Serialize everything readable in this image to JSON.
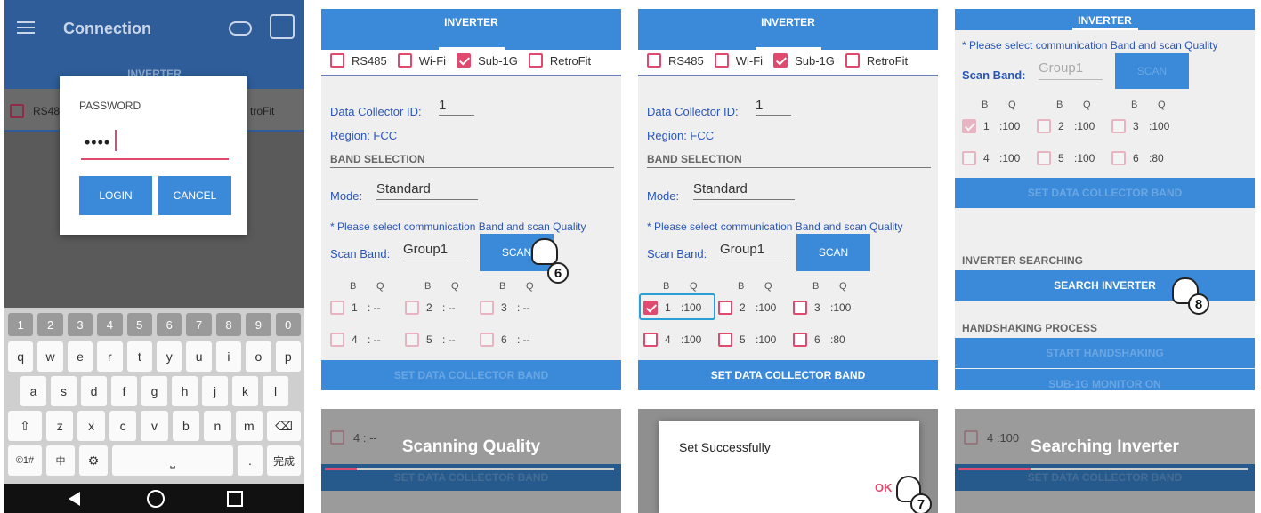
{
  "p1": {
    "title": "Connection",
    "tab": "INVERTER",
    "cb": [
      "RS48",
      "troFit"
    ],
    "dialog_label": "PASSWORD",
    "password": "••••",
    "login": "LOGIN",
    "cancel": "CANCEL",
    "num_keys": [
      "1",
      "2",
      "3",
      "4",
      "5",
      "6",
      "7",
      "8",
      "9",
      "0"
    ],
    "row1": [
      "q",
      "w",
      "e",
      "r",
      "t",
      "y",
      "u",
      "i",
      "o",
      "p"
    ],
    "row2": [
      "a",
      "s",
      "d",
      "f",
      "g",
      "h",
      "j",
      "k",
      "l"
    ],
    "row3": [
      "z",
      "x",
      "c",
      "v",
      "b",
      "n",
      "m"
    ],
    "sym": "©1#",
    "done": "完成"
  },
  "p2": {
    "tab": "INVERTER",
    "cbs": [
      "RS485",
      "Wi-Fi",
      "Sub-1G",
      "RetroFit"
    ],
    "dc_label": "Data Collector ID:",
    "dc_val": "1",
    "region": "Region:  FCC",
    "band_sel": "BAND SELECTION",
    "mode_label": "Mode:",
    "mode_val": "Standard",
    "note": "* Please select communication Band and scan Quality",
    "scan_band": "Scan Band:",
    "group": "Group1",
    "scan": "SCAN",
    "bq": [
      "B",
      "Q"
    ],
    "opts": [
      [
        "1",
        ":  --"
      ],
      [
        "2",
        ":  --"
      ],
      [
        "3",
        ":  --"
      ],
      [
        "4",
        ":  --"
      ],
      [
        "5",
        ":  --"
      ],
      [
        "6",
        ":  --"
      ]
    ],
    "set_btn": "SET DATA COLLECTOR BAND",
    "step": "6"
  },
  "p3": {
    "tab": "INVERTER",
    "cbs": [
      "RS485",
      "Wi-Fi",
      "Sub-1G",
      "RetroFit"
    ],
    "dc_label": "Data Collector ID:",
    "dc_val": "1",
    "region": "Region:  FCC",
    "band_sel": "BAND SELECTION",
    "mode_label": "Mode:",
    "mode_val": "Standard",
    "note": "* Please select communication Band and scan Quality",
    "scan_band": "Scan Band:",
    "group": "Group1",
    "scan": "SCAN",
    "bq": [
      "B",
      "Q"
    ],
    "opts": [
      [
        "1",
        ":100"
      ],
      [
        "2",
        ":100"
      ],
      [
        "3",
        ":100"
      ],
      [
        "4",
        ":100"
      ],
      [
        "5",
        ":100"
      ],
      [
        "6",
        ":80"
      ]
    ],
    "set_btn": "SET DATA COLLECTOR BAND"
  },
  "p4": {
    "tab": "INVERTER",
    "note": "* Please select communication Band and scan Quality",
    "scan_band": "Scan Band:",
    "group": "Group1",
    "scan": "SCAN",
    "bq": [
      "B",
      "Q"
    ],
    "opts": [
      [
        "1",
        ":100"
      ],
      [
        "2",
        ":100"
      ],
      [
        "3",
        ":100"
      ],
      [
        "4",
        ":100"
      ],
      [
        "5",
        ":100"
      ],
      [
        "6",
        ":80"
      ]
    ],
    "set_btn": "SET DATA COLLECTOR BAND",
    "inv_search": "INVERTER SEARCHING",
    "search_btn": "SEARCH INVERTER",
    "handshake": "HANDSHAKING PROCESS",
    "start_hs": "START HANDSHAKING",
    "monitor": "SUB-1G MONITOR ON",
    "step": "8"
  },
  "b1": {
    "title": "Scanning Quality",
    "bg_row": "4 :  --",
    "bg_bar": "SET DATA COLLECTOR BAND",
    "progress": 0.11
  },
  "b2": {
    "message": "Set Successfully",
    "ok": "OK",
    "step": "7"
  },
  "b3": {
    "title": "Searching Inverter",
    "bg_row": "4 :100",
    "bg_bar": "SET DATA COLLECTOR BAND",
    "progress": 0.25
  }
}
